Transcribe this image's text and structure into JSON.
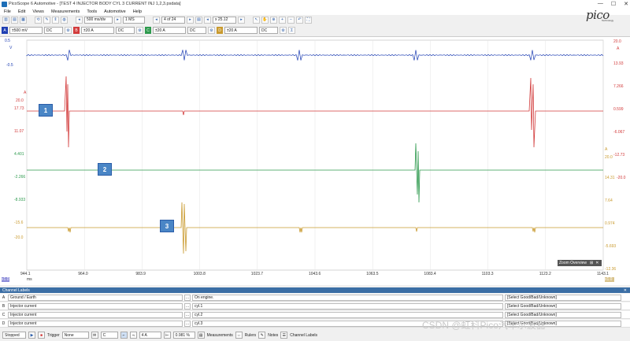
{
  "window": {
    "title": "PicoScope 6 Automotive - [TEST 4 INJECTOR BODY CYL 3 CURRENT INJ 1,2,3.psdata]",
    "controls": [
      "—",
      "☐",
      "✕"
    ]
  },
  "menu": [
    "File",
    "Edit",
    "Views",
    "Measurements",
    "Tools",
    "Automotive",
    "Help"
  ],
  "logo": {
    "text": "pico",
    "sub": "Technology"
  },
  "toolbar": {
    "timebase": "500 ms/div",
    "samples": "1 MS",
    "buffer": "4 of 24",
    "zoom": "x 25.12"
  },
  "channels": [
    {
      "letter": "A",
      "color": "#1f3fb3",
      "range": "±500 mV",
      "coupling": "DC"
    },
    {
      "letter": "B",
      "color": "#d23b3b",
      "range": "±20 A",
      "coupling": "DC"
    },
    {
      "letter": "C",
      "color": "#2e9a4e",
      "range": "±20 A",
      "coupling": "DC"
    },
    {
      "letter": "D",
      "color": "#c99a2e",
      "range": "±20 A",
      "coupling": "DC"
    }
  ],
  "scope": {
    "left_axis": [
      {
        "text": "0.5",
        "color": "#1f3fb3"
      },
      {
        "text": "V",
        "color": "#1f3fb3"
      },
      {
        "text": "-0.5",
        "color": "#1f3fb3"
      },
      {
        "text": "A",
        "color": "#d23b3b"
      },
      {
        "text": "20.0",
        "color": "#d23b3b"
      },
      {
        "text": "17.73",
        "color": "#d23b3b"
      },
      {
        "text": "11.07",
        "color": "#d23b3b"
      },
      {
        "text": "4.401",
        "color": "#2e9a4e"
      },
      {
        "text": "-2.266",
        "color": "#2e9a4e"
      },
      {
        "text": "-8.933",
        "color": "#2e9a4e"
      },
      {
        "text": "-15.6",
        "color": "#c99a2e"
      },
      {
        "text": "-20.0",
        "color": "#c99a2e"
      }
    ],
    "right_axis": [
      {
        "text": "20.0",
        "color": "#d23b3b"
      },
      {
        "text": "A",
        "color": "#d23b3b"
      },
      {
        "text": "13.93",
        "color": "#d23b3b"
      },
      {
        "text": "7.266",
        "color": "#d23b3b"
      },
      {
        "text": "0.599",
        "color": "#d23b3b"
      },
      {
        "text": "-6.067",
        "color": "#d23b3b"
      },
      {
        "text": "-12.73",
        "color": "#d23b3b"
      },
      {
        "text": "A",
        "color": "#c99a2e"
      },
      {
        "text": "20.0",
        "color": "#c99a2e"
      },
      {
        "text": "14.31",
        "color": "#c99a2e"
      },
      {
        "text": "-20.0",
        "color": "#d23b3b"
      },
      {
        "text": "7.64",
        "color": "#c99a2e"
      },
      {
        "text": "0.974",
        "color": "#c99a2e"
      },
      {
        "text": "-5.693",
        "color": "#c99a2e"
      },
      {
        "text": "-12.36",
        "color": "#c99a2e"
      }
    ],
    "x_ticks": [
      "944.1",
      "964.0",
      "983.9",
      "1003.8",
      "1023.7",
      "1043.6",
      "1063.5",
      "1083.4",
      "1103.3",
      "1123.2",
      "1143.1"
    ],
    "x_unit": "ms",
    "markers": [
      "1",
      "2",
      "3"
    ],
    "zoom_overview_label": "Zoom Overview",
    "bottom_left_value": "x1.0",
    "bottom_right_value": "x1.0"
  },
  "channel_labels": {
    "header": "Channel Labels",
    "rows": [
      {
        "letter": "A",
        "type": "Ground / Earth",
        "note": "On engine.",
        "rating": "[Select Good/Bad/Unknown]"
      },
      {
        "letter": "B",
        "type": "Injector current",
        "note": "cyl.1",
        "rating": "[Select Good/Bad/Unknown]"
      },
      {
        "letter": "C",
        "type": "Injector current",
        "note": "cyl.2",
        "rating": "[Select Good/Bad/Unknown]"
      },
      {
        "letter": "D",
        "type": "Injector current",
        "note": "cyl.3",
        "rating": "[Select Good/Bad/Unknown]"
      }
    ]
  },
  "status": {
    "state": "Stopped",
    "trigger_label": "Trigger",
    "trigger_mode": "None",
    "trigger_channel": "C",
    "threshold": "4 A",
    "pretrigger": "0.981 %",
    "measurements": "Measurements",
    "rulers": "Rulers",
    "notes": "Notes",
    "channel_labels": "Channel Labels"
  },
  "watermark": "CSDN @虹科Pico汽车示波器"
}
